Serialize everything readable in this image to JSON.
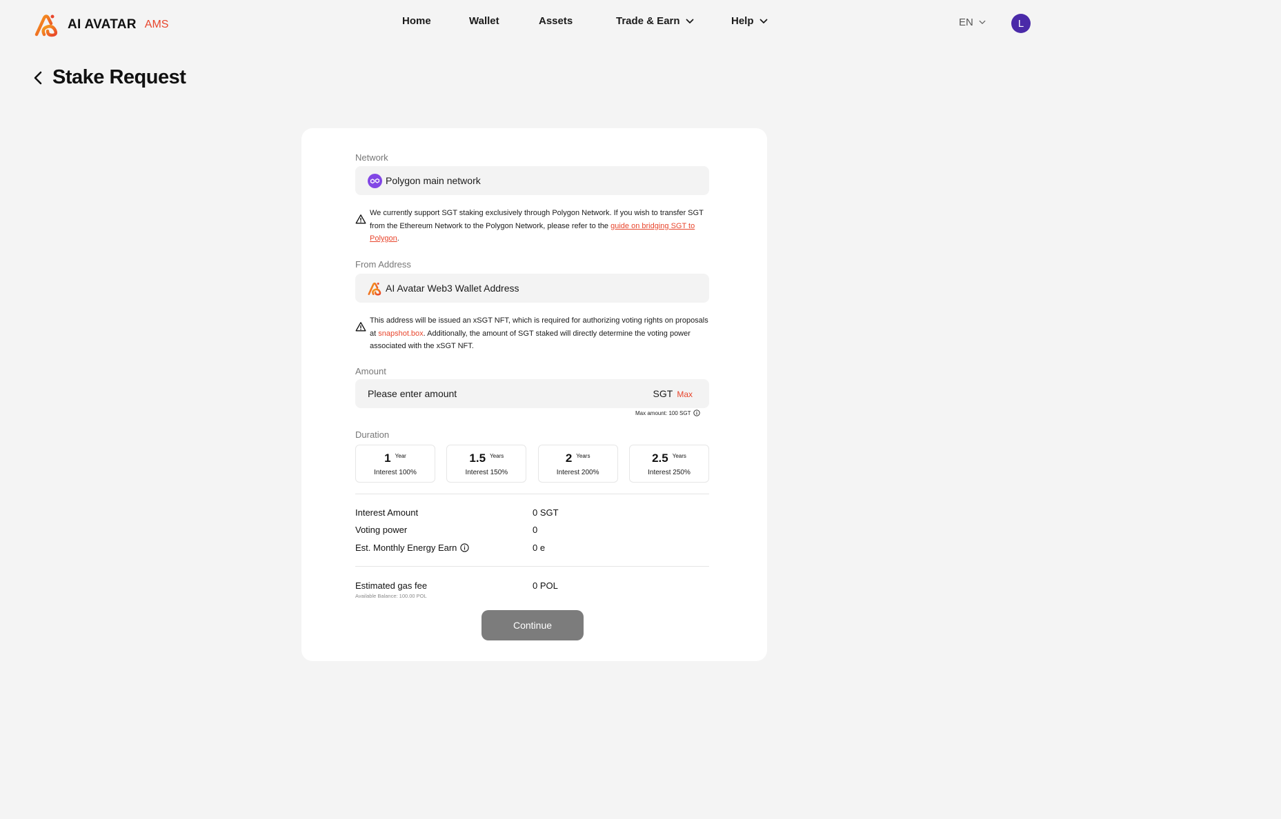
{
  "header": {
    "logo_text": "AI AVATAR",
    "logo_badge": "AMS",
    "nav": {
      "home": "Home",
      "wallet": "Wallet",
      "assets": "Assets",
      "trade": "Trade & Earn",
      "help": "Help"
    },
    "language": "EN",
    "avatar_initial": "L"
  },
  "page": {
    "title": "Stake Request"
  },
  "form": {
    "network": {
      "label": "Network",
      "value": "Polygon main network",
      "notice_pre": "We currently support SGT staking exclusively through Polygon Network. If you wish to transfer SGT from the Ethereum Network to the Polygon Network, please refer to the ",
      "notice_link": "guide on bridging SGT to Polygon",
      "notice_post": "."
    },
    "from_address": {
      "label": "From Address",
      "value": "AI Avatar Web3 Wallet Address",
      "notice_pre": "This address will be issued an xSGT NFT, which is required for authorizing voting rights on proposals at ",
      "notice_link": "snapshot.box",
      "notice_post": ". Additionally, the amount of SGT staked will directly determine the voting power associated with the xSGT NFT."
    },
    "amount": {
      "label": "Amount",
      "placeholder": "Please enter amount",
      "unit": "SGT",
      "max_label": "Max",
      "max_note": "Max amount: 100 SGT"
    },
    "duration": {
      "label": "Duration",
      "options": [
        {
          "num": "1",
          "unit": "Year",
          "interest": "Interest 100%"
        },
        {
          "num": "1.5",
          "unit": "Years",
          "interest": "Interest 150%"
        },
        {
          "num": "2",
          "unit": "Years",
          "interest": "Interest 200%"
        },
        {
          "num": "2.5",
          "unit": "Years",
          "interest": "Interest 250%"
        }
      ]
    },
    "summary": {
      "interest_label": "Interest Amount",
      "interest_value": "0 SGT",
      "voting_label": "Voting power",
      "voting_value": "0",
      "energy_label": "Est. Monthly Energy Earn",
      "energy_value": "0 e"
    },
    "gas": {
      "label": "Estimated gas fee",
      "value": "0 POL",
      "balance_note": "Available Balance: 100.00 POL"
    },
    "continue_label": "Continue"
  },
  "colors": {
    "accent": "#e8452c",
    "avatar": "#4a2aa8",
    "polygon": "#8247e5",
    "button_disabled": "#7c7c7c"
  },
  "icons": [
    "logo-icon",
    "chevron-down-icon",
    "back-arrow-icon",
    "polygon-icon",
    "warning-icon",
    "info-icon"
  ]
}
